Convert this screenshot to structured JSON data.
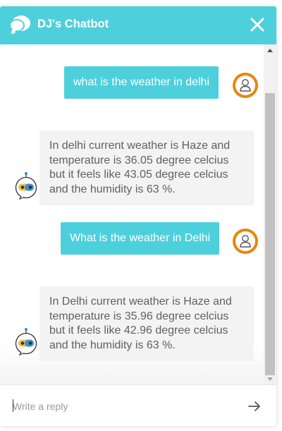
{
  "header": {
    "title": "DJ's Chatbot",
    "logo_icon": "chat-bubbles-icon",
    "close_icon": "close-icon"
  },
  "messages": [
    {
      "from": "user",
      "text": "what is the weather in delhi"
    },
    {
      "from": "bot",
      "lines": [
        "In delhi current weather is Haze and",
        "temperature is 36.05 degree celcius",
        "but it feels like 43.05 degree celcius",
        "and the humidity is 63 %."
      ]
    },
    {
      "from": "user",
      "text": "What is the weather in Delhi"
    },
    {
      "from": "bot",
      "lines": [
        "In Delhi current weather is Haze and",
        "temperature is 35.96 degree celcius",
        "but it feels like 42.96 degree celcius",
        "and the humidity is 63 %."
      ]
    }
  ],
  "composer": {
    "placeholder": "Write a reply",
    "value": "",
    "send_icon": "send-arrow-icon"
  },
  "colors": {
    "accent": "#4dd0dc",
    "avatar_ring": "#e8860a",
    "bot_bubble": "#f3f3f3",
    "bot_text": "#606060"
  }
}
